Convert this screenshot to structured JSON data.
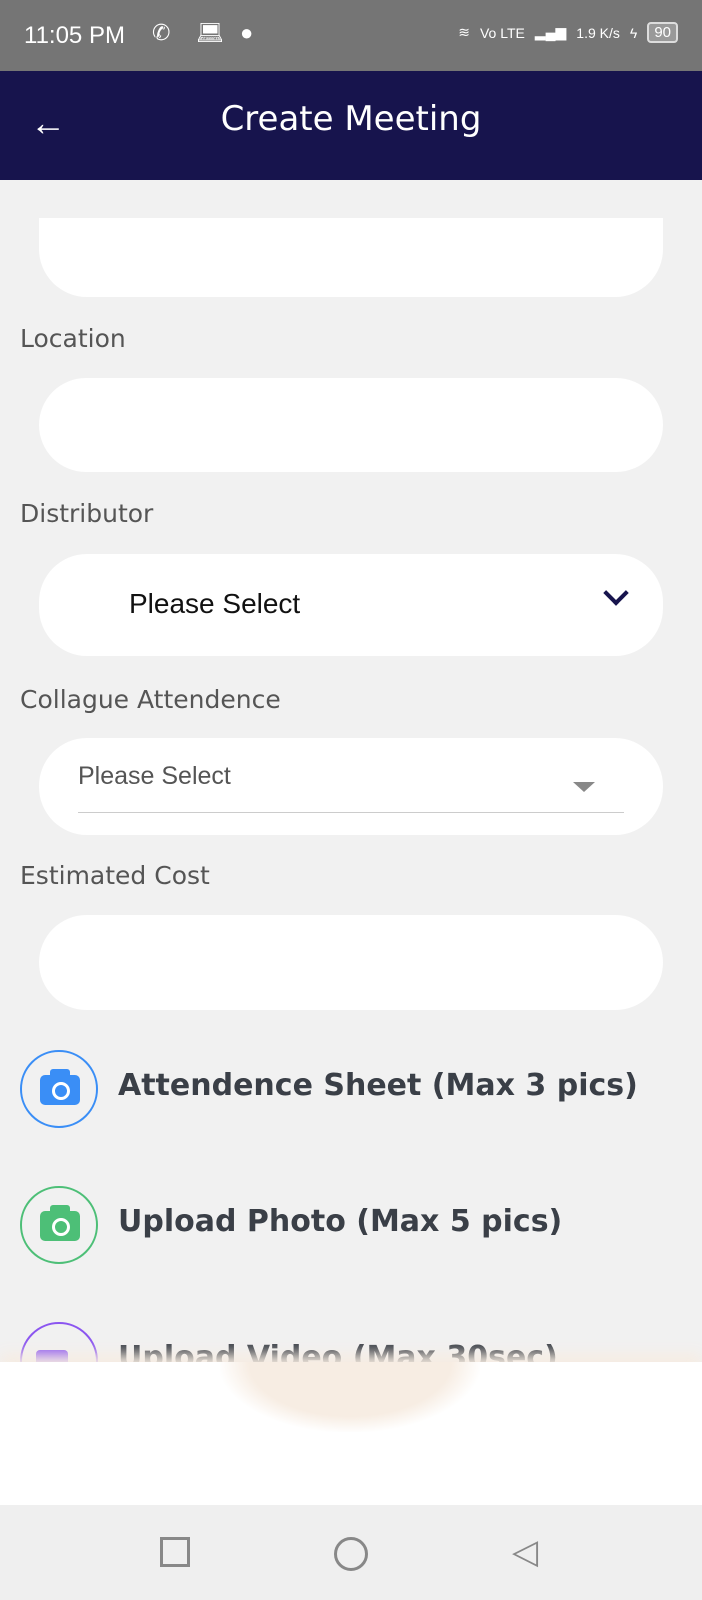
{
  "status_bar": {
    "time": "11:05 PM",
    "network": "Vo LTE",
    "speed": "1.9 K/s",
    "battery": "90"
  },
  "header": {
    "title": "Create Meeting"
  },
  "form": {
    "location_label": "Location",
    "distributor_label": "Distributor",
    "distributor_value": "Please Select",
    "colleague_label": "Collague Attendence",
    "colleague_value": "Please Select",
    "cost_label": "Estimated Cost"
  },
  "uploads": [
    {
      "label": "Attendence Sheet (Max 3 pics)",
      "icon": "camera-icon",
      "color": "#3a8ef6"
    },
    {
      "label": "Upload Photo (Max 5 pics)",
      "icon": "camera-icon",
      "color": "#4dbf77"
    },
    {
      "label": "Upload Video (Max 30sec)",
      "icon": "video-icon",
      "color": "#8b55f0"
    }
  ]
}
